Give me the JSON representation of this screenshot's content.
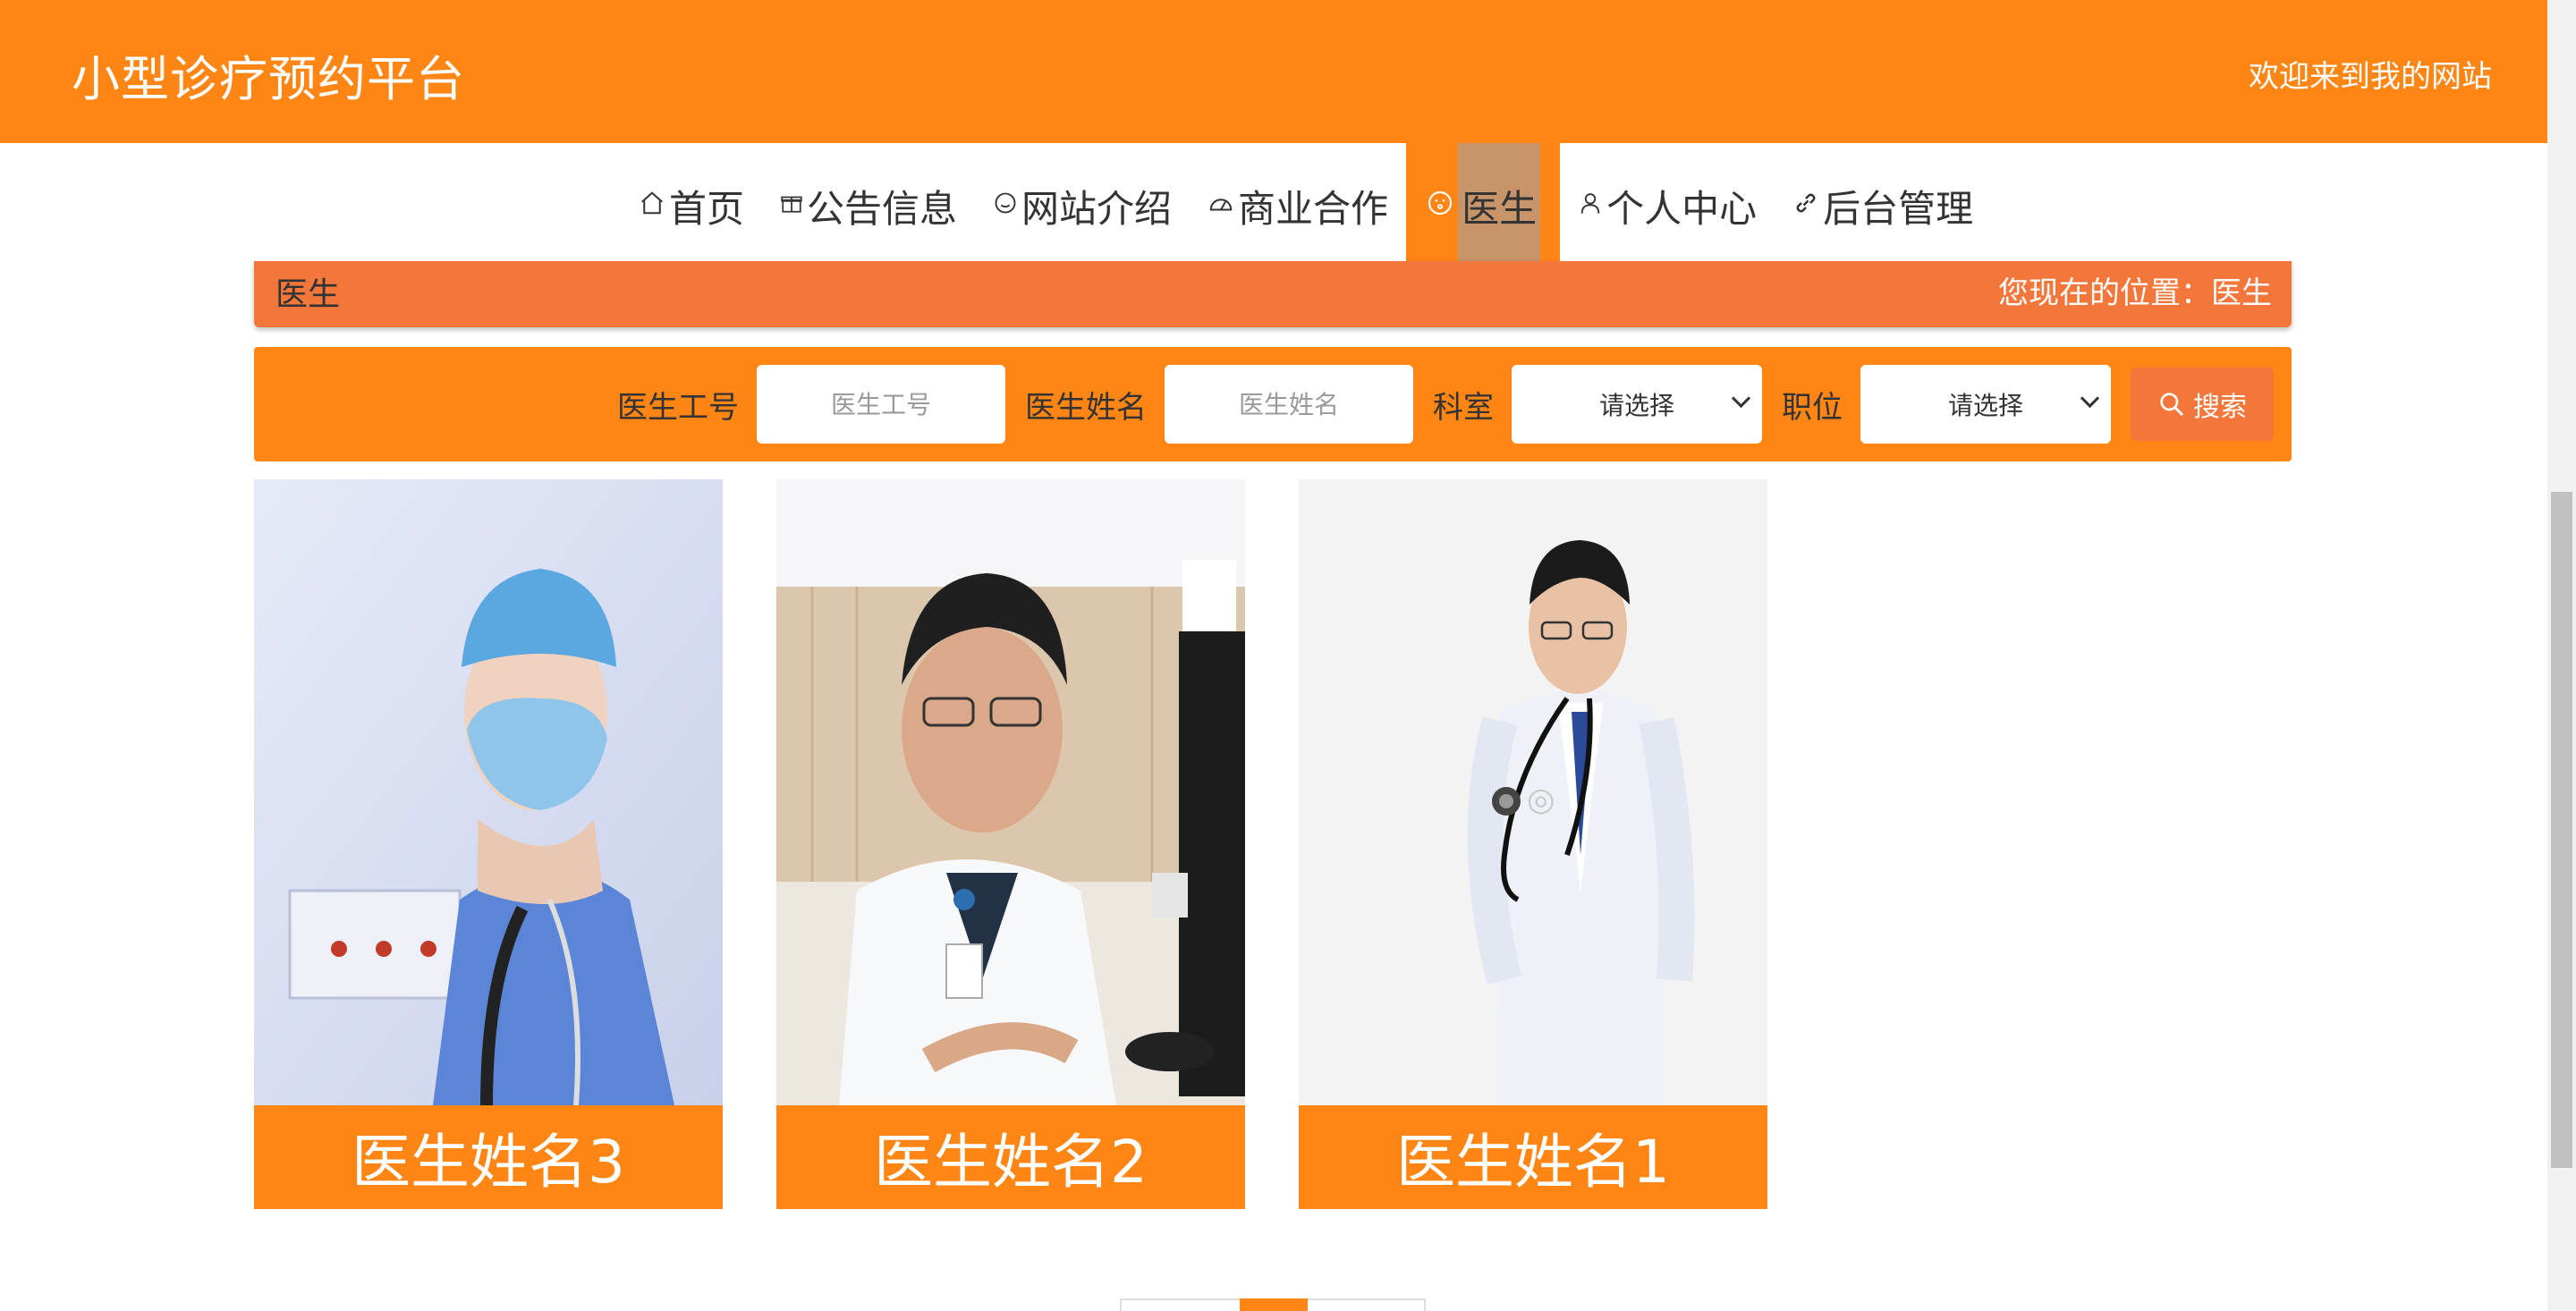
{
  "header": {
    "title": "小型诊疗预约平台",
    "welcome": "欢迎来到我的网站"
  },
  "nav": {
    "items": [
      {
        "label": "首页",
        "icon": "home-icon"
      },
      {
        "label": "公告信息",
        "icon": "gift-icon"
      },
      {
        "label": "网站介绍",
        "icon": "smile-icon"
      },
      {
        "label": "商业合作",
        "icon": "gauge-icon"
      },
      {
        "label": "医生",
        "icon": "face-icon",
        "active": true
      },
      {
        "label": "个人中心",
        "icon": "user-icon"
      },
      {
        "label": "后台管理",
        "icon": "link-icon"
      }
    ]
  },
  "breadcrumb": {
    "title": "医生",
    "location": "您现在的位置：医生"
  },
  "search": {
    "doctor_id_label": "医生工号",
    "doctor_id_placeholder": "医生工号",
    "doctor_name_label": "医生姓名",
    "doctor_name_placeholder": "医生姓名",
    "department_label": "科室",
    "department_value": "请选择",
    "position_label": "职位",
    "position_value": "请选择",
    "button_label": "搜索"
  },
  "doctors": [
    {
      "name": "医生姓名3"
    },
    {
      "name": "医生姓名2"
    },
    {
      "name": "医生姓名1"
    }
  ],
  "colors": {
    "primary": "#ff8514",
    "secondary": "#f3763a",
    "active_label": "#c8956a"
  }
}
